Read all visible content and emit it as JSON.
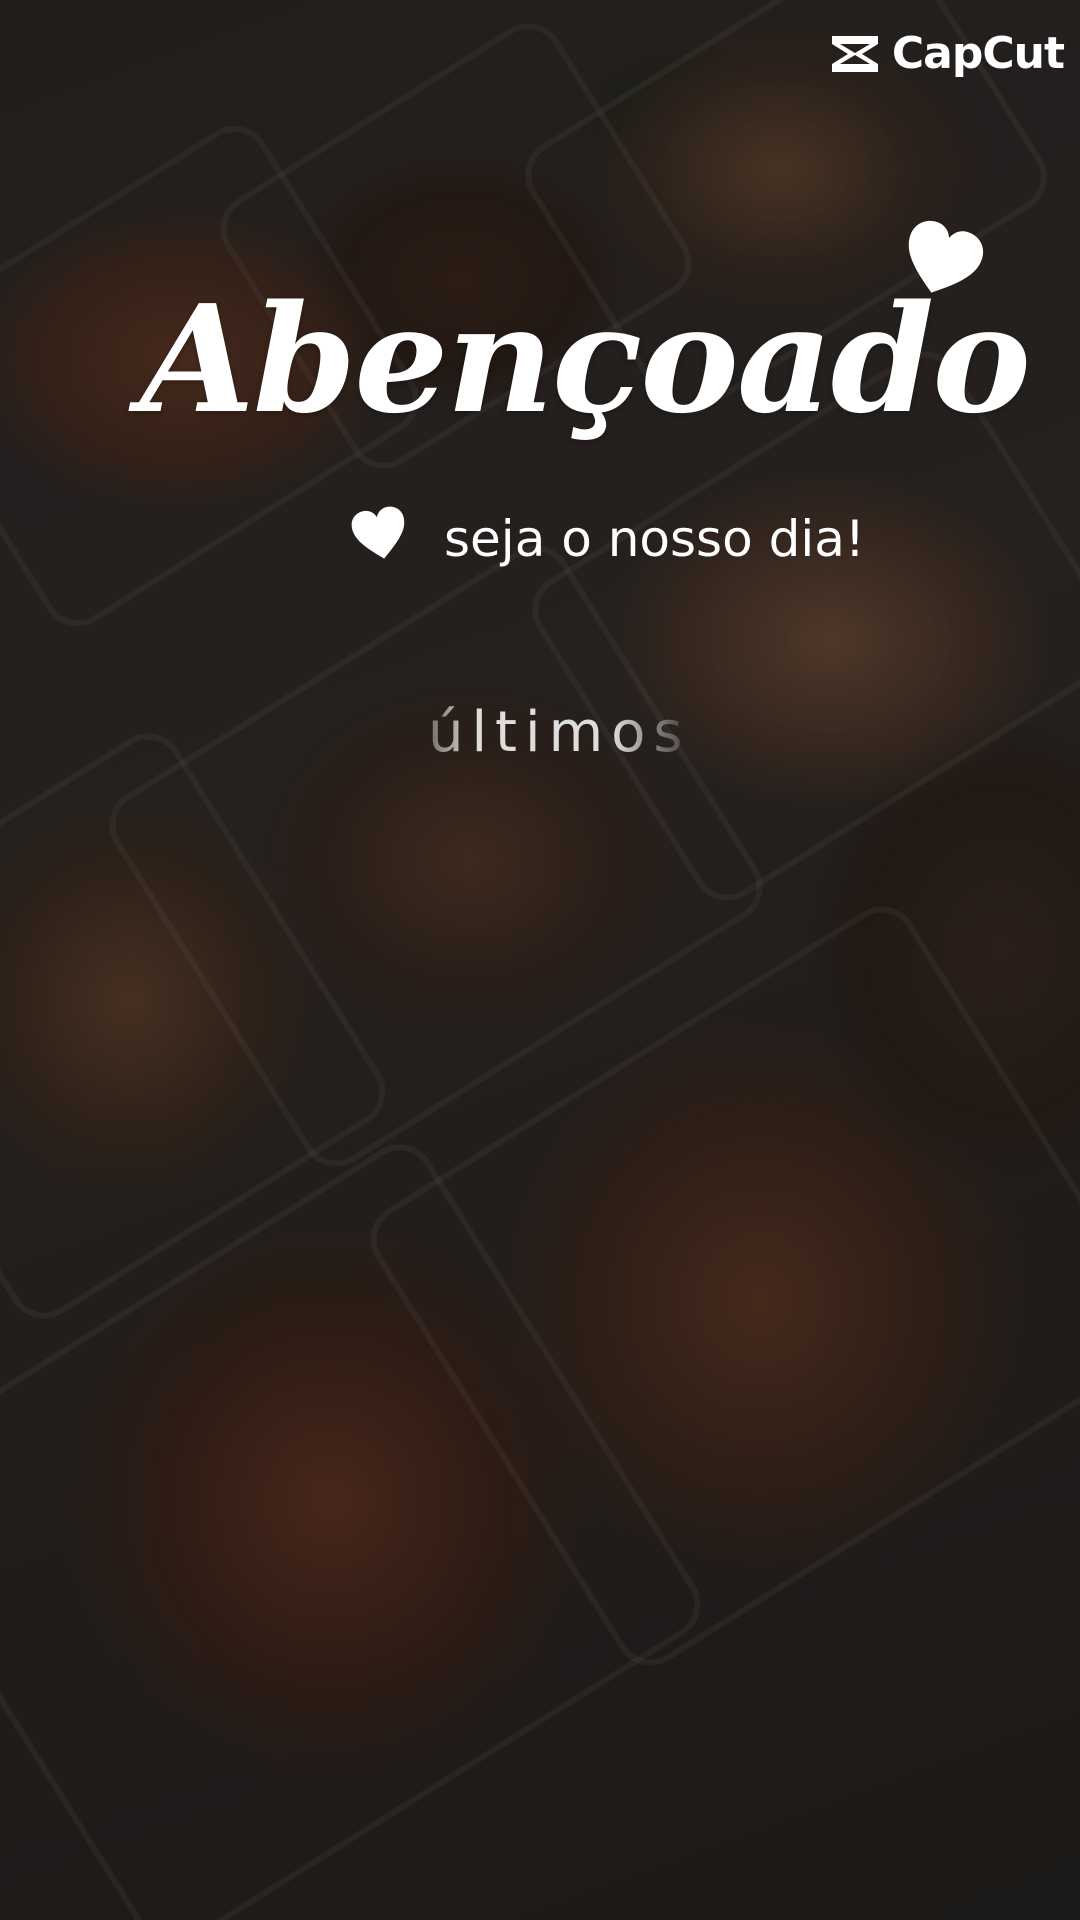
{
  "watermark": {
    "brand": "CapCut",
    "logo_icon": "capcut-logo-icon"
  },
  "caption": {
    "title": "Abençoado",
    "subtitle": "seja o nosso dia!",
    "animated_word": "últimos"
  },
  "decorations": {
    "hearts": [
      "heart-icon",
      "heart-icon"
    ]
  },
  "colors": {
    "text": "#ffffff",
    "overlay": "#141212"
  }
}
